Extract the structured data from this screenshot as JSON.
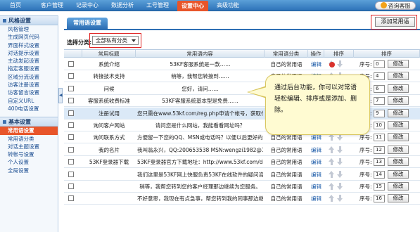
{
  "nav": {
    "items": [
      {
        "label": "首页"
      },
      {
        "label": "客户管理"
      },
      {
        "label": "记录中心"
      },
      {
        "label": "数据分析"
      },
      {
        "label": "工号管理"
      },
      {
        "label": "设置中心",
        "active": true
      },
      {
        "label": "高级功能"
      }
    ],
    "consult_label": "咨询客服"
  },
  "sidebar": {
    "sections": [
      {
        "title": "风格设置",
        "items": [
          "风格管理",
          "生成网页代码",
          "界面样式设置",
          "对话提示设置",
          "主动发起设置",
          "指定客服设置",
          "区域分流设置",
          "访客注册设置",
          "访客留言设置",
          "自定义URL",
          "400电话设置"
        ]
      },
      {
        "title": "基本设置",
        "items": [
          "常用语设置",
          "常用语分类",
          "对话主题设置",
          "转帐号设置",
          "个人设置",
          "全局设置"
        ],
        "active_item": "常用语设置"
      }
    ]
  },
  "main": {
    "tab_label": "常用语设置",
    "add_button_label": "添加常用语",
    "filter_label": "选择分类:",
    "filter_value": "全部私有分类",
    "columns": [
      "",
      "常用标题",
      "常用语内容",
      "常用语分类",
      "操作",
      "排序",
      "排序"
    ],
    "seq_label": "序号:",
    "edit_label": "编辑",
    "modify_label": "修改",
    "rows": [
      {
        "title": "系统介绍",
        "content": "53KF客服系统是一款……",
        "category": "自己的常用语",
        "seq": "0"
      },
      {
        "title": "转接技术支持",
        "content": "稍等，我帮您转接到……",
        "category": "自己的常用语",
        "seq": "4"
      },
      {
        "title": "问候",
        "content": "您好，请问……",
        "category": "自己的常用语",
        "seq": "6"
      },
      {
        "title": "客服系统收费标准",
        "content": "53KF客服系统基本型是免费……",
        "category": "自己的常用语",
        "seq": "7"
      },
      {
        "title": "注册试用",
        "content": "您只需在www.53kf.com/reg.php申请个帐号，获取代…",
        "category": "自己的常用语",
        "seq": "9",
        "highlight": true
      },
      {
        "title": "询问客户网站",
        "content": "请问您是什么网站，我能看看网址吗？",
        "category": "自己的常用语",
        "seq": "10"
      },
      {
        "title": "询问联系方式",
        "content": "方便留一下您的QQ、MSN或电话吗？以便以后更好的…",
        "category": "自己的常用语",
        "seq": "11"
      },
      {
        "title": "我的名片",
        "content": "我叫翁永兴，QQ:200653538 MSN:wengzi1982@163…",
        "category": "自己的常用语",
        "seq": "12"
      },
      {
        "title": "53KF登录器下载",
        "content": "53KF登录器官方下载地址：http://www.53kf.com/down…",
        "category": "自己的常用语",
        "seq": "13"
      },
      {
        "title": "",
        "content": "我们这里是53KF网上快服负责53KF在线软件的疑问咨…",
        "category": "自己的常用语",
        "seq": "14"
      },
      {
        "title": "",
        "content": "稍等，我帮您转到您的客户经理那边继续为您服务。",
        "category": "自己的常用语",
        "seq": "15"
      },
      {
        "title": "",
        "content": "不好意思，我现在有点急事，帮您转到我的同事那边继…",
        "category": "自己的常用语",
        "seq": "16"
      }
    ]
  },
  "callout": {
    "text": "通过后台功能，你可以对常语轻松编辑、排序或是添加、删除。"
  },
  "colors": {
    "nav_blue": "#2d72b8",
    "active_orange": "#e8552a",
    "link_blue": "#1a5aa8",
    "annotation_red": "#e02222",
    "bubble_yellow": "#fffbd2"
  }
}
